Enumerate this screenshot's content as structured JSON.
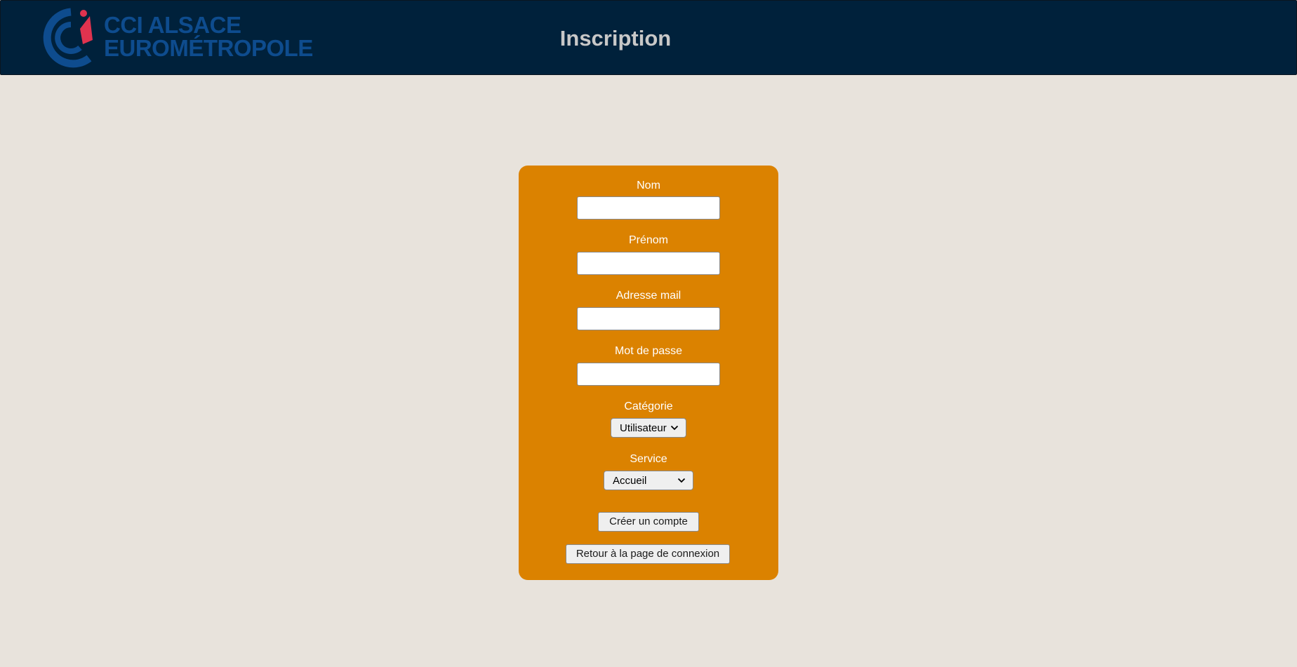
{
  "header": {
    "logo": {
      "line1": "CCI ALSACE",
      "line2": "EUROMÉTROPOLE",
      "brand_color": "#0e4c8e",
      "accent_color": "#e0334f"
    },
    "title": "Inscription",
    "background": "#00213b"
  },
  "form": {
    "background": "#db8200",
    "fields": {
      "nom": {
        "label": "Nom",
        "value": ""
      },
      "prenom": {
        "label": "Prénom",
        "value": ""
      },
      "email": {
        "label": "Adresse mail",
        "value": ""
      },
      "password": {
        "label": "Mot de passe",
        "value": ""
      }
    },
    "categorie": {
      "label": "Catégorie",
      "selected": "Utilisateur"
    },
    "service": {
      "label": "Service",
      "selected": "Accueil"
    },
    "create_button": "Créer un compte",
    "back_button": "Retour à la page de connexion"
  }
}
